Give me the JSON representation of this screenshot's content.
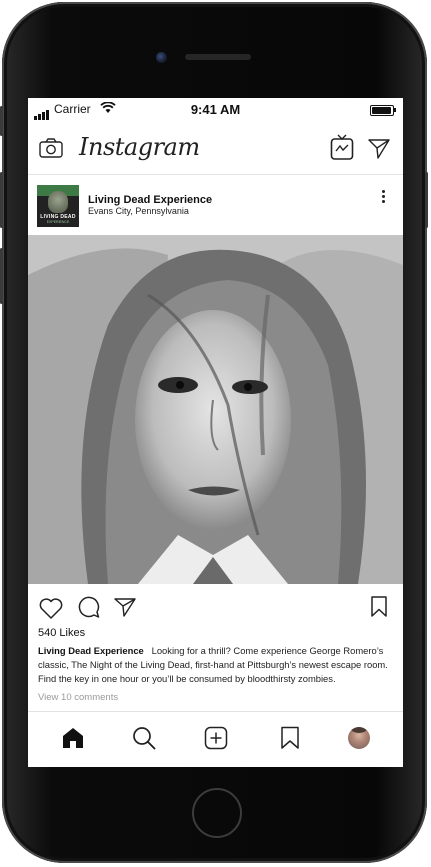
{
  "status": {
    "carrier": "Carrier",
    "time": "9:41 AM"
  },
  "app": {
    "title": "Instagram"
  },
  "post": {
    "account_name": "Living Dead Experience",
    "location": "Evans City, Pennsylvania",
    "avatar_text": "LIVING DEAD",
    "avatar_subtext": "EXPERIENCE",
    "likes": "540 Likes",
    "caption_user": "Living Dead Experience",
    "caption_text": "Looking for a thrill? Come experience George Romero’s classic, The Night of the Living Dead, first-hand at Pittsburgh’s newest escape room. Find the key in one hour or you’ll be consumed by bloodthirsty zombies.",
    "view_comments": "View 10 comments"
  },
  "icons": {
    "header": [
      "camera-icon",
      "igtv-icon",
      "direct-message-icon"
    ],
    "post_actions": [
      "heart-icon",
      "comment-icon",
      "share-icon",
      "bookmark-icon"
    ],
    "tabs": [
      "home-icon",
      "search-icon",
      "add-post-icon",
      "saved-icon",
      "profile-avatar"
    ]
  },
  "colors": {
    "text": "#111111",
    "muted": "#9a9a9a",
    "divider": "#e2e2e2"
  }
}
